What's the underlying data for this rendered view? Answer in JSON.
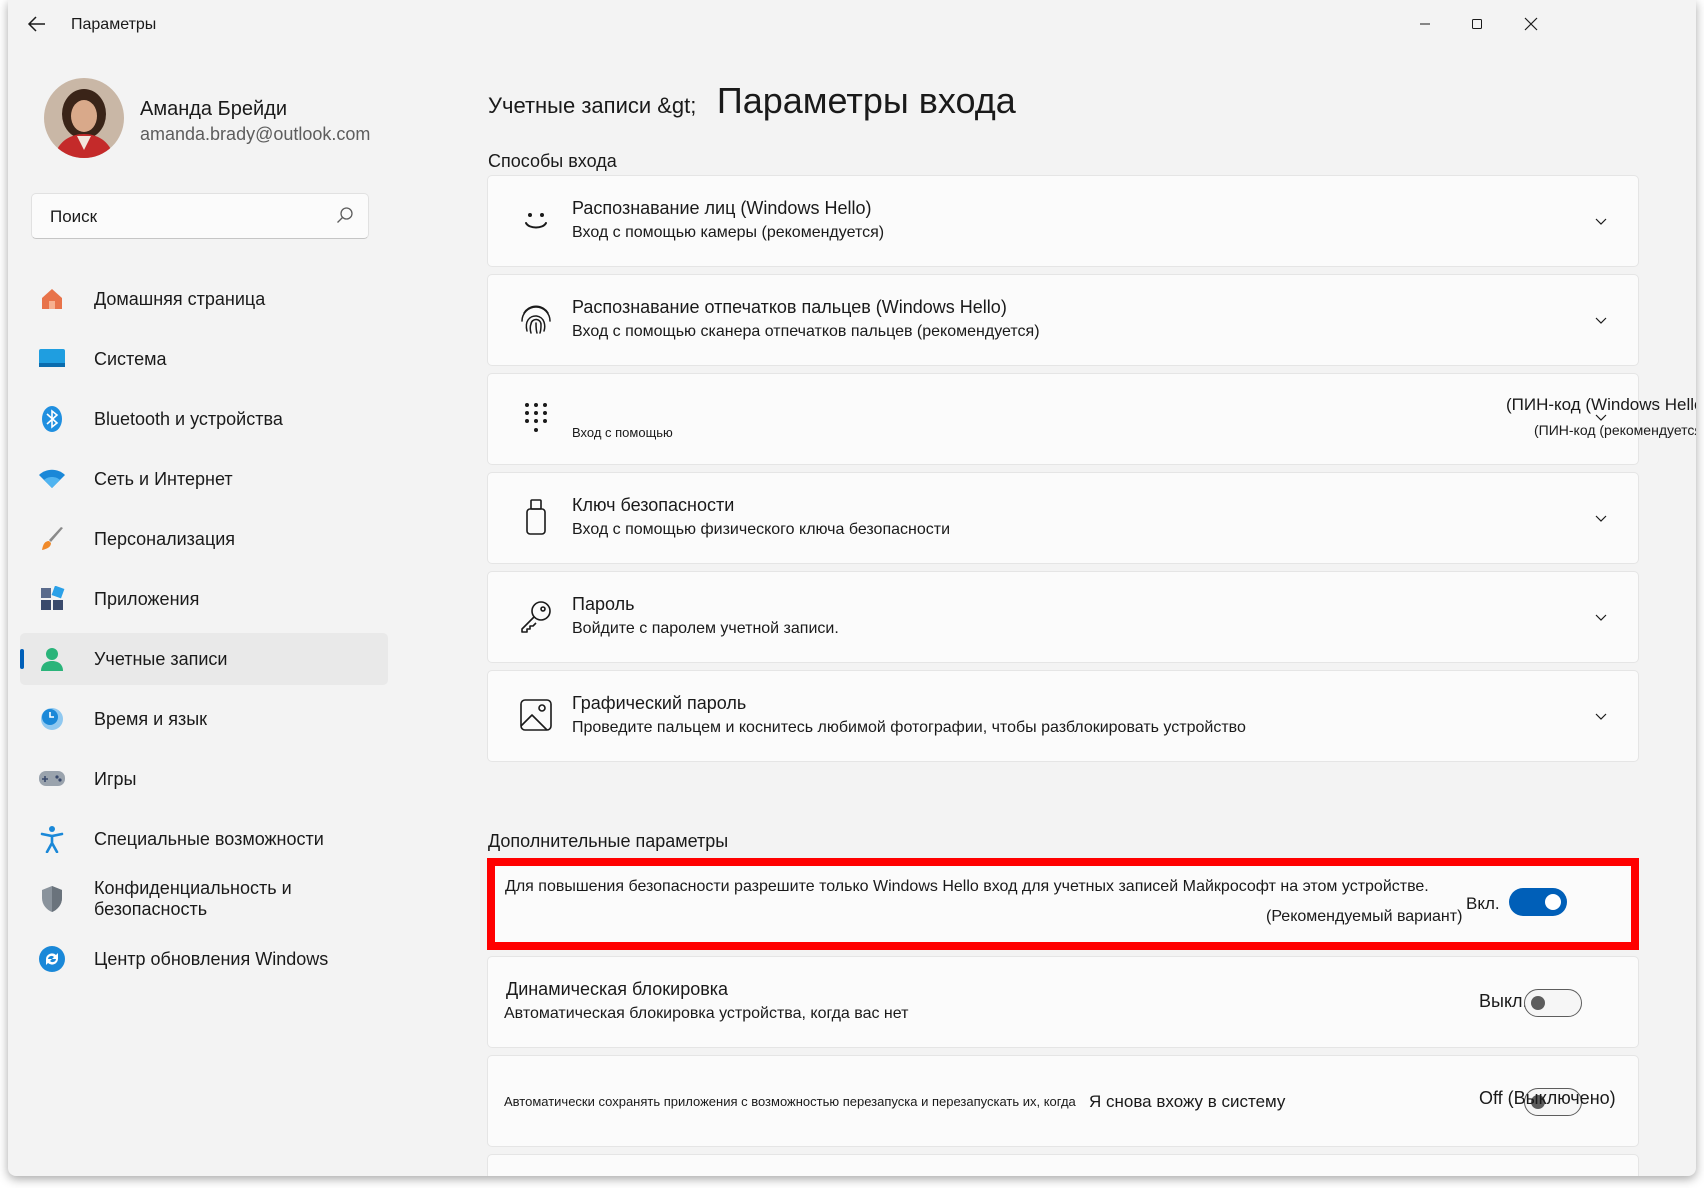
{
  "window": {
    "title": "Параметры"
  },
  "user": {
    "name": "Аманда Брейди",
    "email": "amanda.brady@outlook.com"
  },
  "search": {
    "placeholder": "Поиск"
  },
  "nav": [
    {
      "label": "Домашняя страница",
      "icon": "home-icon"
    },
    {
      "label": "Система",
      "icon": "monitor-icon"
    },
    {
      "label": "Bluetooth и устройства",
      "icon": "bluetooth-icon"
    },
    {
      "label": "Сеть и Интернет",
      "icon": "wifi-icon"
    },
    {
      "label": "Персонализация",
      "icon": "brush-icon"
    },
    {
      "label": "Приложения",
      "icon": "apps-icon"
    },
    {
      "label": "Учетные записи",
      "icon": "account-icon",
      "active": true
    },
    {
      "label": "Время и язык",
      "icon": "clock-globe-icon"
    },
    {
      "label": "Игры",
      "icon": "gamepad-icon"
    },
    {
      "label": "Специальные возможности",
      "icon": "accessibility-icon"
    },
    {
      "label": "Конфиденциальность и безопасность",
      "icon": "shield-icon"
    },
    {
      "label": "Центр обновления Windows",
      "icon": "update-icon"
    }
  ],
  "breadcrumb": {
    "parent": "Учетные записи &gt;",
    "current": "Параметры входа"
  },
  "sections": {
    "signin": "Способы входа",
    "additional": "Дополнительные параметры"
  },
  "methods": [
    {
      "title": "Распознавание лиц (Windows Hello)",
      "desc": "Вход с помощью камеры (рекомендуется)",
      "icon": "face-icon"
    },
    {
      "title": "Распознавание отпечатков пальцев (Windows Hello)",
      "desc": "Вход с помощью сканера отпечатков пальцев (рекомендуется)",
      "icon": "fingerprint-icon"
    },
    {
      "title": "(ПИН-код (Windows Hello",
      "desc": "Вход с помощью",
      "desc2": "(ПИН-код (рекомендуется",
      "icon": "pin-keypad-icon"
    },
    {
      "title": "Ключ безопасности",
      "desc": "Вход с помощью физического ключа безопасности",
      "icon": "usb-key-icon"
    },
    {
      "title": "Пароль",
      "desc": "Войдите с паролем учетной записи.",
      "icon": "key-icon"
    },
    {
      "title": "Графический пароль",
      "desc": "Проведите пальцем и коснитесь любимой фотографии, чтобы разблокировать устройство",
      "icon": "picture-icon"
    }
  ],
  "additional": [
    {
      "text": "Для повышения безопасности разрешите только Windows Hello вход для учетных записей Майкрософт на этом устройстве.",
      "sub": "(Рекомендуемый  вариант)",
      "state": "Вкл.",
      "on": true
    },
    {
      "title": "Динамическая блокировка",
      "desc": "Автоматическая блокировка устройства, когда вас нет",
      "state": "Выкл.",
      "on": false
    },
    {
      "desc": "Автоматически сохранять приложения с возможностью перезапуска и перезапускать их, когда",
      "desc2": "Я снова вхожу в систему",
      "state": "Off (Выключено)",
      "on": false
    }
  ],
  "colors": {
    "accent": "#005fb8",
    "highlight": "#ff0000"
  }
}
